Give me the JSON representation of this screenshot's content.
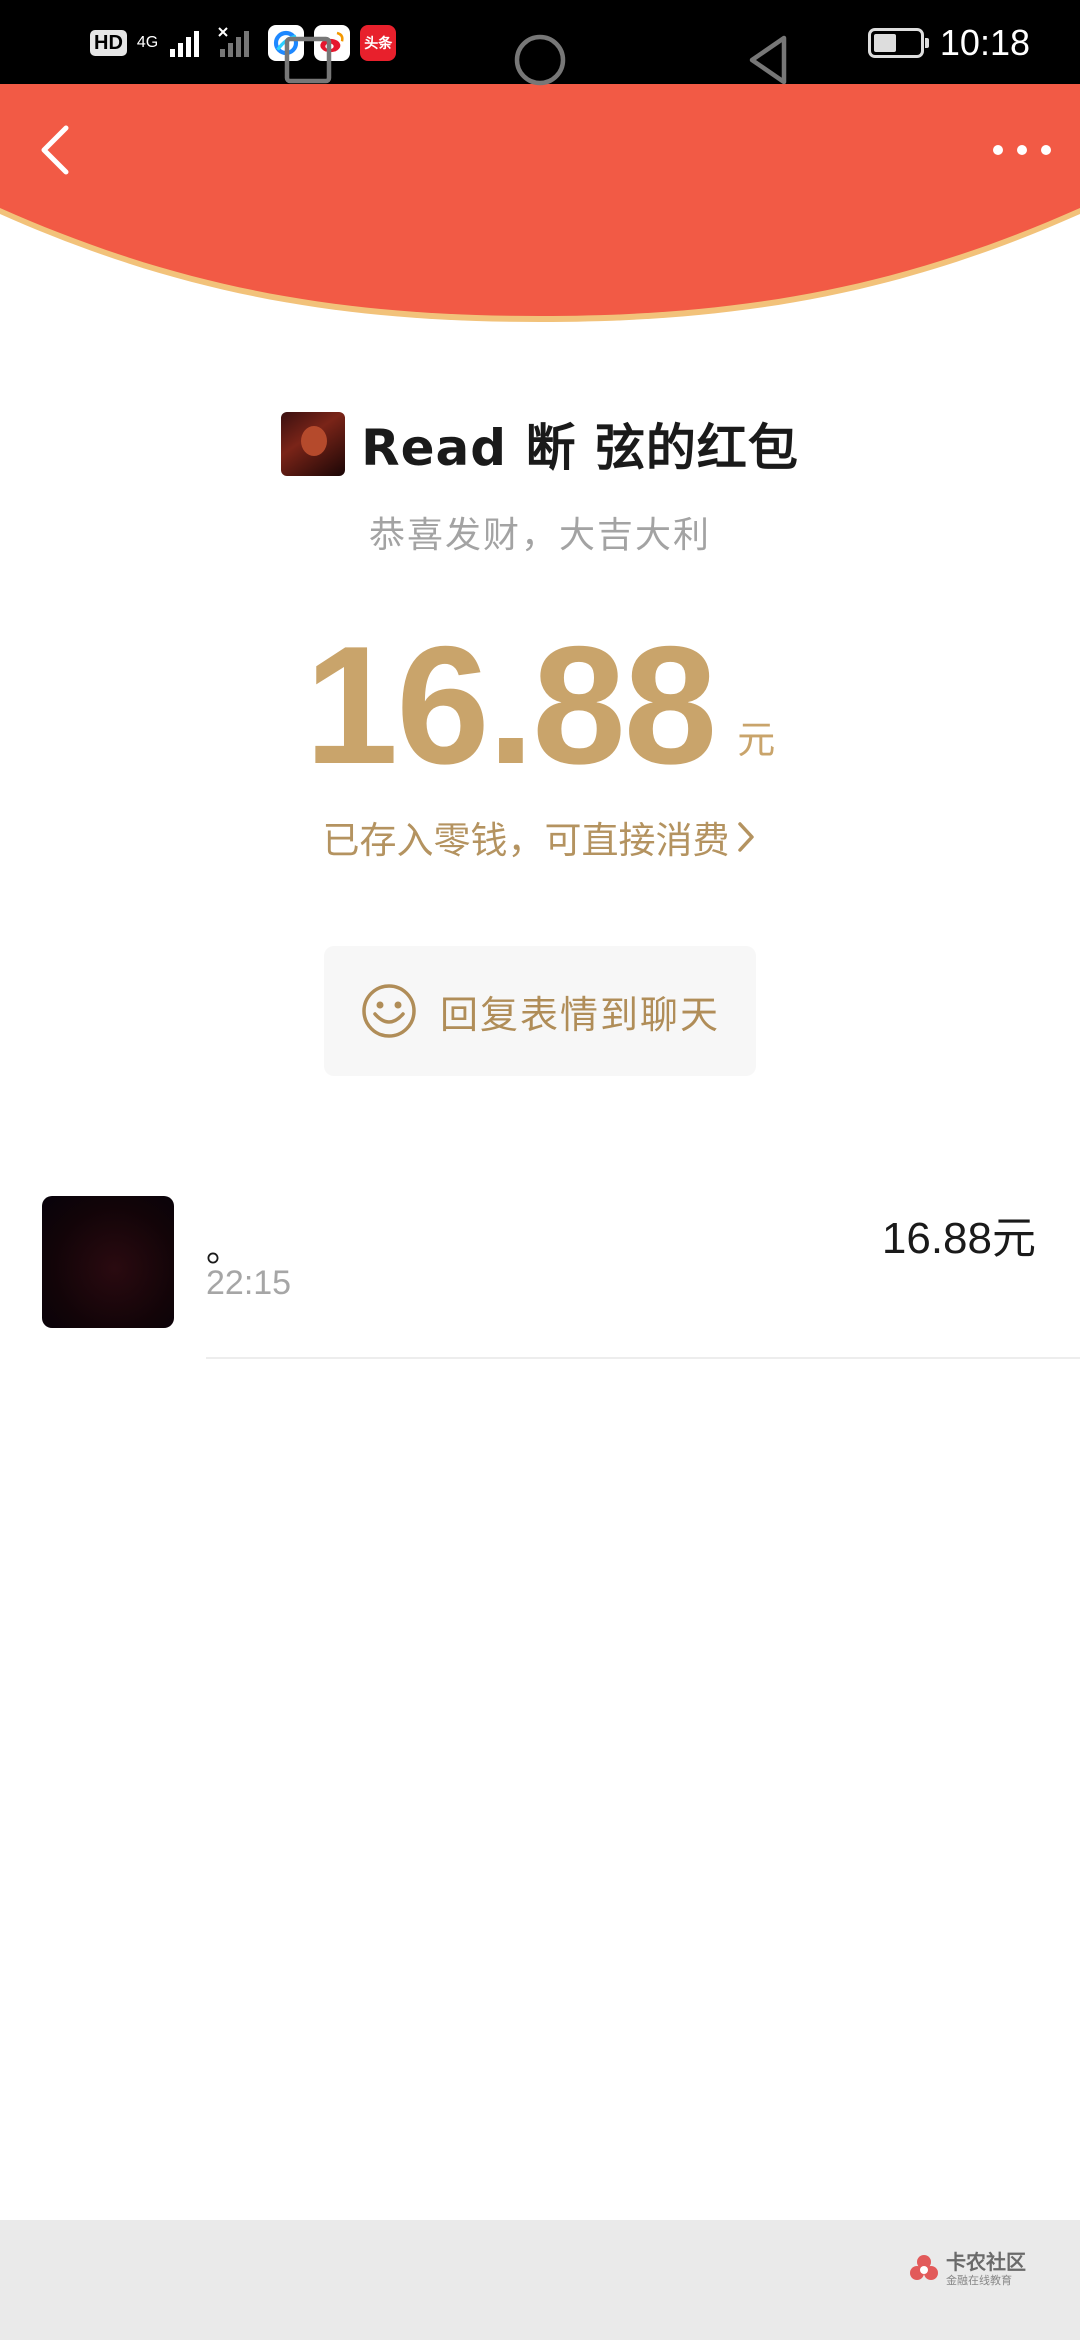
{
  "status_bar": {
    "hd_label": "HD",
    "network_label": "4G",
    "time": "10:18",
    "battery_level": 0.45,
    "app_icons": [
      "qq-browser-icon",
      "weibo-icon",
      "toutiao-icon"
    ],
    "toutiao_label": "头条"
  },
  "header": {
    "color": "#f25a45",
    "border_color": "#f2c27a"
  },
  "packet": {
    "sender_title": "Read 断 弦的红包",
    "greeting": "恭喜发财，大吉大利",
    "amount": "16.88",
    "currency": "元",
    "deposit_note": "已存入零钱，可直接消费",
    "reply_label": "回复表情到聊天",
    "accent_color": "#c9a46b"
  },
  "records": [
    {
      "name": "。",
      "time": "22:15",
      "amount": "16.88元"
    }
  ],
  "watermark": {
    "name": "卡农社区",
    "tagline": "金融在线教育"
  }
}
